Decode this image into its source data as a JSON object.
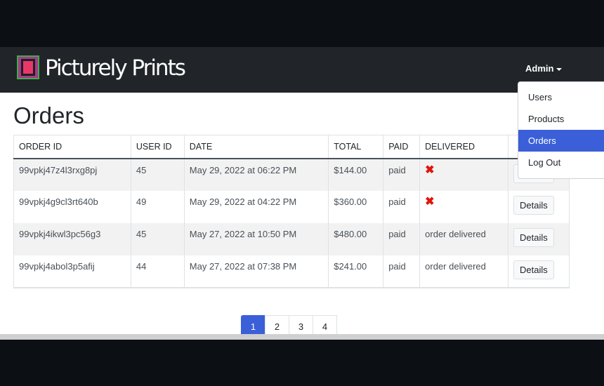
{
  "brand": {
    "name": "Picturely Prints"
  },
  "nav": {
    "admin_label": "Admin",
    "dropdown": [
      {
        "label": "Users",
        "active": false
      },
      {
        "label": "Products",
        "active": false
      },
      {
        "label": "Orders",
        "active": true
      },
      {
        "label": "Log Out",
        "active": false
      }
    ]
  },
  "page": {
    "title": "Orders"
  },
  "table": {
    "headers": [
      "ORDER ID",
      "USER ID",
      "DATE",
      "TOTAL",
      "PAID",
      "DELIVERED",
      ""
    ],
    "rows": [
      {
        "order_id": "99vpkj47z4l3rxg8pj",
        "user_id": "45",
        "date": "May 29, 2022 at 06:22 PM",
        "total": "$144.00",
        "paid": "paid",
        "delivered": "✖",
        "action": "Details"
      },
      {
        "order_id": "99vpkj4g9cl3rt640b",
        "user_id": "49",
        "date": "May 29, 2022 at 04:22 PM",
        "total": "$360.00",
        "paid": "paid",
        "delivered": "✖",
        "action": "Details"
      },
      {
        "order_id": "99vpkj4ikwl3pc56g3",
        "user_id": "45",
        "date": "May 27, 2022 at 10:50 PM",
        "total": "$480.00",
        "paid": "paid",
        "delivered": "order delivered",
        "action": "Details"
      },
      {
        "order_id": "99vpkj4abol3p5afij",
        "user_id": "44",
        "date": "May 27, 2022 at 07:38 PM",
        "total": "$241.00",
        "paid": "paid",
        "delivered": "order delivered",
        "action": "Details"
      }
    ]
  },
  "pagination": {
    "pages": [
      "1",
      "2",
      "3",
      "4"
    ],
    "active": "1"
  },
  "colors": {
    "navbar": "#212529",
    "accent": "#3a5fd8",
    "not_delivered": "#e0150d"
  }
}
